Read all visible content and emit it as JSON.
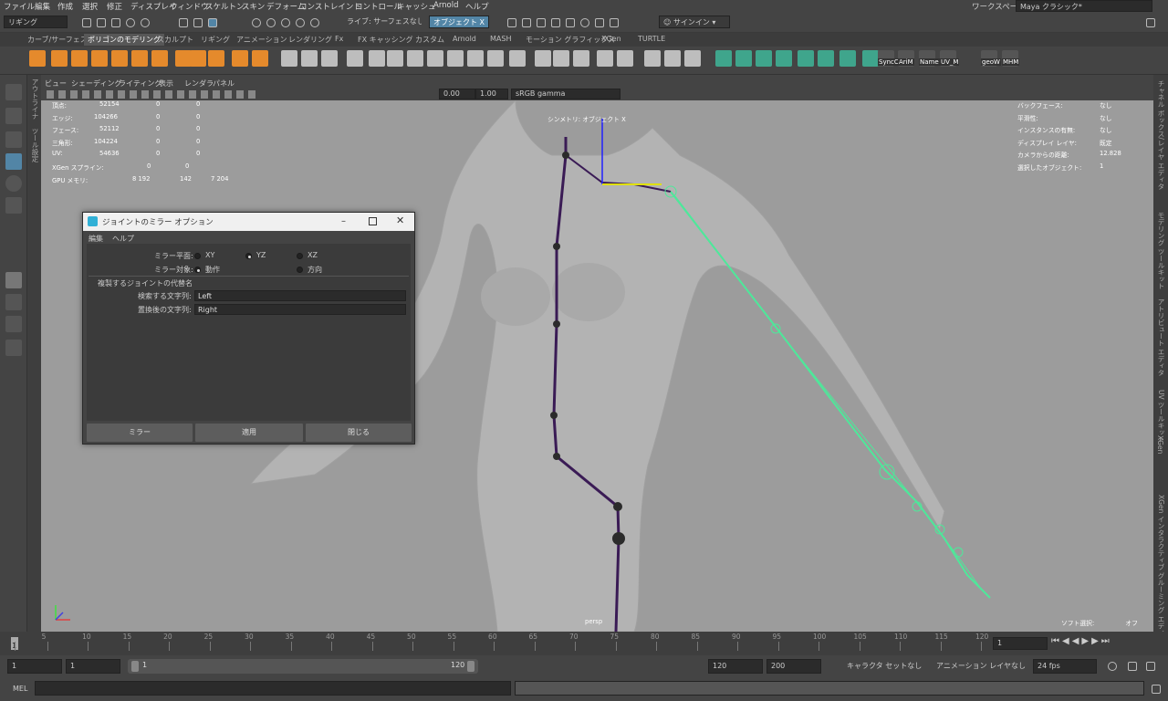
{
  "menubar": {
    "items": [
      "ファイル",
      "編集",
      "作成",
      "選択",
      "修正",
      "ディスプレイ",
      "ウィンドウ",
      "スケルトン",
      "スキン",
      "デフォーム",
      "コンストレイント",
      "コントロール",
      "キャッシュ",
      "Arnold",
      "ヘルプ"
    ],
    "workspace_label": "ワークスペース:",
    "workspace_value": "Maya クラシック*"
  },
  "statusline": {
    "menuset": "リギング",
    "live_surface": "ライブ: サーフェスなし",
    "object_mode": "オブジェクト X",
    "sign_in": "サインイン"
  },
  "shelf": {
    "tabs": [
      "カーブ/サーフェス",
      "ポリゴンのモデリング",
      "スカルプト",
      "リギング",
      "アニメーション",
      "レンダリング",
      "Fx",
      "FX キャッシング",
      "カスタム",
      "Arnold",
      "MASH",
      "モーション グラフィックス",
      "XGen",
      "TURTLE"
    ],
    "active_tab": "ポリゴンのモデリング",
    "labels": [
      "SyncC",
      "AriM",
      "Name",
      "UV_M",
      "geoW",
      "MHM"
    ]
  },
  "left_strip": {
    "outliner": "アウトライナ",
    "tool_settings": "ツール設定"
  },
  "right_strip": {
    "items": [
      "チャネル ボックス/レイヤ エディタ",
      "モデリング ツールキット",
      "アトリビュート エディタ",
      "UV ツールキット",
      "XGen",
      "XGen インタラクティブ グルーミング エディタ"
    ]
  },
  "panel": {
    "menus": [
      "ビュー",
      "シェーディング",
      "ライティング",
      "表示",
      "レンダラ",
      "パネル"
    ],
    "exposure": "0.00",
    "gamma": "1.00",
    "colorspace": "sRGB gamma"
  },
  "hud": {
    "rows": [
      {
        "label": "頂点:",
        "v1": "52154",
        "v2": "0",
        "v3": "0"
      },
      {
        "label": "エッジ:",
        "v1": "104266",
        "v2": "0",
        "v3": "0"
      },
      {
        "label": "フェース:",
        "v1": "52112",
        "v2": "0",
        "v3": "0"
      },
      {
        "label": "三角形:",
        "v1": "104224",
        "v2": "0",
        "v3": "0"
      },
      {
        "label": "UV:",
        "v1": "54636",
        "v2": "0",
        "v3": "0"
      },
      {
        "label": "XGen スプライン:",
        "v1": "0",
        "v2": "0",
        "v3": ""
      },
      {
        "label": "GPU メモリ:",
        "v1": "8 192",
        "v2": "142",
        "v3": "7 204"
      }
    ],
    "right": [
      {
        "label": "バックフェース:",
        "value": "なし"
      },
      {
        "label": "平滑性:",
        "value": "なし"
      },
      {
        "label": "インスタンスの有無:",
        "value": "なし"
      },
      {
        "label": "ディスプレイ レイヤ:",
        "value": "既定"
      },
      {
        "label": "カメラからの距離:",
        "value": "12.828"
      },
      {
        "label": "選択したオブジェクト:",
        "value": "1"
      }
    ],
    "symmetry": "シンメトリ: オブジェクト X",
    "camera": "persp",
    "soft_select_label": "ソフト選択:",
    "soft_select_value": "オフ"
  },
  "dialog": {
    "title": "ジョイントのミラー オプション",
    "menus": [
      "編集",
      "ヘルプ"
    ],
    "mirror_plane_label": "ミラー平面:",
    "plane_options": [
      "XY",
      "YZ",
      "XZ"
    ],
    "plane_selected": "YZ",
    "mirror_function_label": "ミラー対象:",
    "function_options": [
      "動作",
      "方向"
    ],
    "function_selected": "動作",
    "section_title": "複製するジョイントの代替名",
    "search_label": "検索する文字列:",
    "search_value": "Left",
    "replace_label": "置換後の文字列:",
    "replace_value": "Right",
    "buttons": [
      "ミラー",
      "適用",
      "閉じる"
    ]
  },
  "timeline": {
    "ticks": [
      "1",
      "5",
      "10",
      "15",
      "20",
      "25",
      "30",
      "35",
      "40",
      "45",
      "50",
      "55",
      "60",
      "65",
      "70",
      "75",
      "80",
      "85",
      "90",
      "95",
      "100",
      "105",
      "110",
      "115",
      "120"
    ],
    "current_frame": "1"
  },
  "range": {
    "start": "1",
    "anim_start": "1",
    "slider_start": "1",
    "slider_end": "120",
    "end": "120",
    "anim_end": "200",
    "character_set": "キャラクタ セットなし",
    "anim_layer": "アニメーション レイヤなし",
    "fps": "24 fps"
  },
  "cmdline": {
    "lang": "MEL"
  },
  "colors": {
    "accent_blue": "#5285a6",
    "shelf_orange": "#e58a2c",
    "joint_green": "#4ee89a",
    "viewport_bg": "#9c9c9c"
  }
}
